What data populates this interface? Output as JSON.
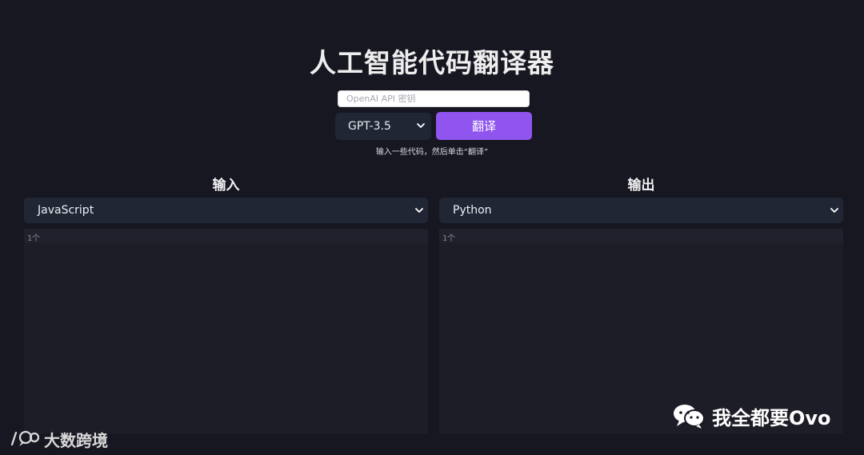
{
  "header": {
    "title": "人工智能代码翻译器"
  },
  "controls": {
    "api_placeholder": "OpenAI API 密钥",
    "model_selected": "GPT-3.5",
    "translate_label": "翻译",
    "hint": "输入一些代码，然后单击“翻译”"
  },
  "input_panel": {
    "heading": "输入",
    "language_selected": "JavaScript",
    "line_number": "1个"
  },
  "output_panel": {
    "heading": "输出",
    "language_selected": "Python",
    "line_number": "1个"
  },
  "watermarks": {
    "left": "大数跨境",
    "right": "我全都要Ovo"
  },
  "icons": {
    "dropdown": "chevron-down-icon",
    "left_logo": "speech-bubble-logo-icon",
    "wechat": "wechat-icon"
  },
  "colors": {
    "background": "#161720",
    "panel": "#1d1d28",
    "select": "#202634",
    "accent": "#8f55ee"
  }
}
